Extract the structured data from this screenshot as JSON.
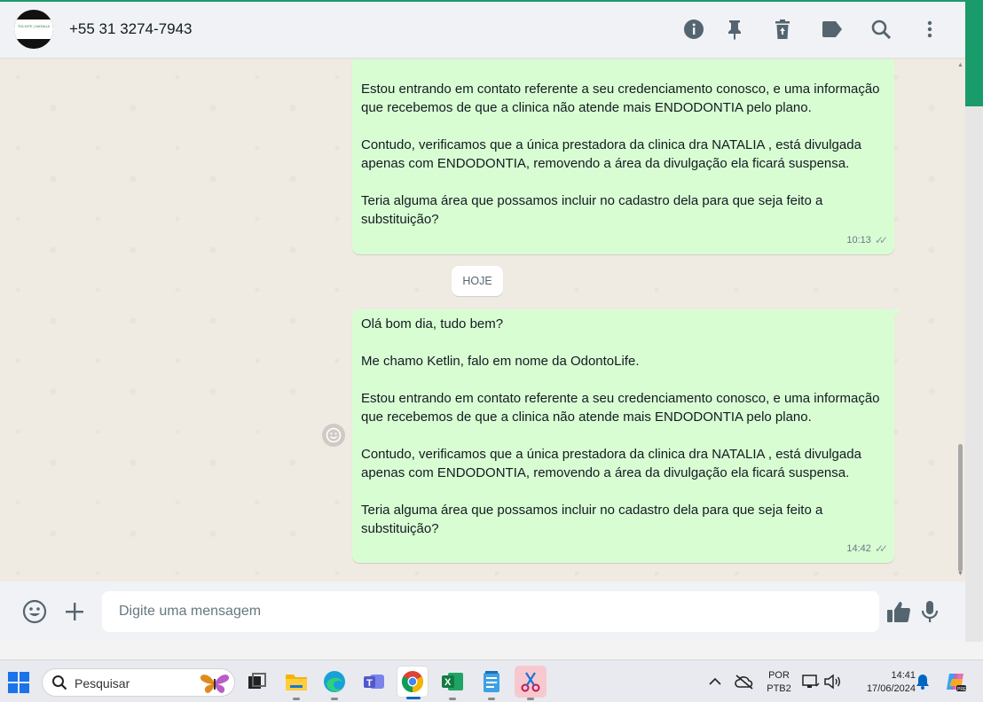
{
  "header": {
    "contact_name": "+55 31 3274-7943",
    "avatar_text": "TOLHITE | NATALIA",
    "icons": [
      "info-icon",
      "pin-icon",
      "delete-icon",
      "label-icon",
      "search-icon",
      "menu-icon"
    ]
  },
  "chat": {
    "messages": [
      {
        "text": "Estou entrando em contato referente a seu credenciamento conosco, e uma informação que recebemos de que a clinica não atende mais ENDODONTIA pelo plano.\n\nContudo, verificamos que a única prestadora da clinica dra NATALIA , está divulgada apenas com ENDODONTIA, removendo a área da divulgação ela ficará suspensa.\n\nTeria alguma área que possamos incluir no cadastro dela para que seja feito a substituição?",
        "time": "10:13"
      },
      {
        "text": "Olá bom dia, tudo bem?\n\nMe chamo Ketlin, falo em nome da OdontoLife.\n\nEstou entrando em contato referente a seu credenciamento conosco, e uma informação que recebemos de que a clinica não atende mais ENDODONTIA pelo plano.\n\nContudo, verificamos que a única prestadora da clinica dra NATALIA , está divulgada apenas com ENDODONTIA, removendo a área da divulgação ela ficará suspensa.\n\nTeria alguma área que possamos incluir no cadastro dela para que seja feito a substituição?",
        "time": "14:42"
      }
    ],
    "date_divider": "HOJE"
  },
  "composer": {
    "placeholder": "Digite uma mensagem"
  },
  "taskbar": {
    "search_label": "Pesquisar",
    "language_line1": "POR",
    "language_line2": "PTB2",
    "time": "14:41",
    "date": "17/06/2024",
    "apps": [
      "task-view",
      "file-explorer",
      "edge",
      "teams",
      "chrome",
      "excel",
      "notepad",
      "snipping-tool"
    ]
  },
  "colors": {
    "accent": "#1a9b6b",
    "outgoing_bubble": "#d9fdd3",
    "chat_bg": "#efeae2",
    "header_bg": "#f0f2f5"
  }
}
